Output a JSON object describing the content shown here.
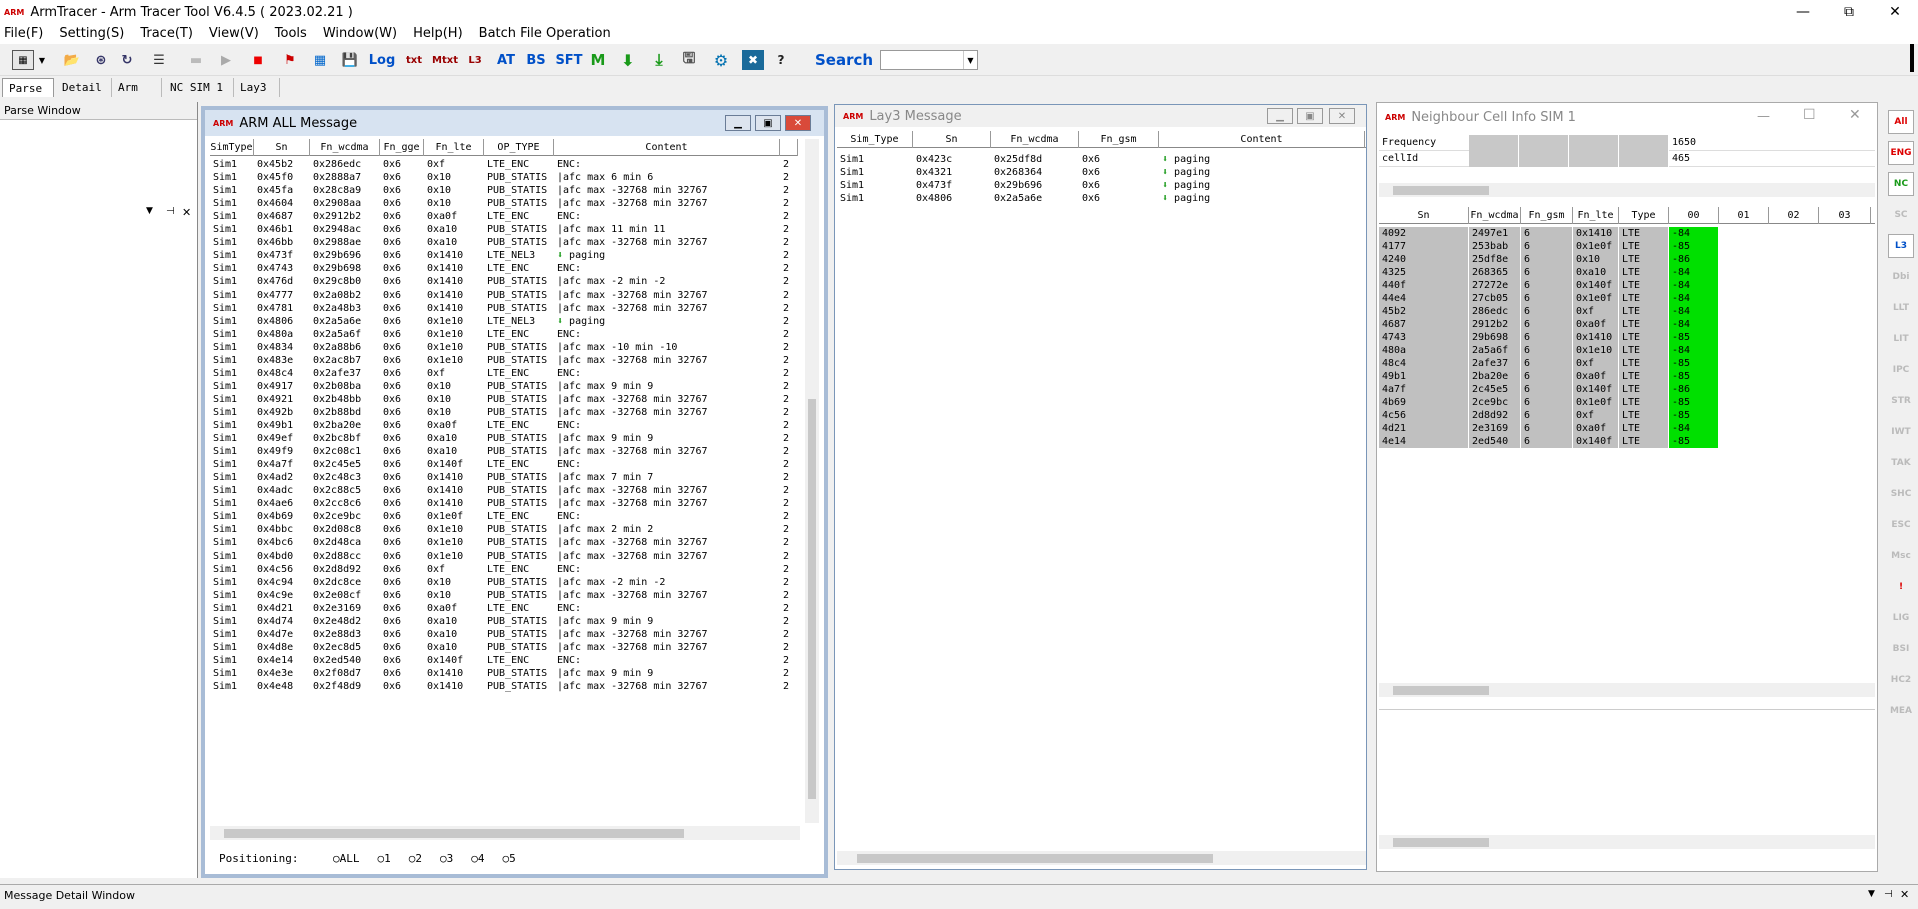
{
  "window": {
    "title": "ArmTracer - Arm Tracer Tool V6.4.5 ( 2023.02.21 )",
    "logo": "ARM",
    "btn_min": "—",
    "btn_max": "⧉",
    "btn_close": "✕"
  },
  "menu": [
    "File(F)",
    "Setting(S)",
    "Trace(T)",
    "View(V)",
    "Tools",
    "Window(W)",
    "Help(H)",
    "Batch File Operation"
  ],
  "toolbar": {
    "log": "Log",
    "txt": "txt",
    "mtxt": "Mtxt",
    "l3": "L3",
    "at": "AT",
    "bs": "BS",
    "sft": "SFT",
    "m": "M",
    "search": "Search"
  },
  "tabs": [
    "Parse",
    "Detail",
    "Arm",
    "NC SIM 1",
    "Lay3"
  ],
  "parse_window": {
    "title": "Parse Window"
  },
  "arm_all": {
    "title": "ARM ALL Message",
    "columns": [
      "SimType",
      "Sn",
      "Fn_wcdma",
      "Fn_gge",
      "Fn_lte",
      "OP_TYPE",
      "Content"
    ],
    "rows": [
      [
        "Sim1",
        "0x45b2",
        "0x286edc",
        "0x6",
        "0xf",
        "LTE_ENC",
        "ENC:"
      ],
      [
        "Sim1",
        "0x45f0",
        "0x2888a7",
        "0x6",
        "0x10",
        "PUB_STATIS",
        "|afc max 6 min 6"
      ],
      [
        "Sim1",
        "0x45fa",
        "0x28c8a9",
        "0x6",
        "0x10",
        "PUB_STATIS",
        "|afc max -32768 min 32767"
      ],
      [
        "Sim1",
        "0x4604",
        "0x2908aa",
        "0x6",
        "0x10",
        "PUB_STATIS",
        "|afc max -32768 min 32767"
      ],
      [
        "Sim1",
        "0x4687",
        "0x2912b2",
        "0x6",
        "0xa0f",
        "LTE_ENC",
        "ENC:"
      ],
      [
        "Sim1",
        "0x46b1",
        "0x2948ac",
        "0x6",
        "0xa10",
        "PUB_STATIS",
        "|afc max 11 min 11"
      ],
      [
        "Sim1",
        "0x46bb",
        "0x2988ae",
        "0x6",
        "0xa10",
        "PUB_STATIS",
        "|afc max -32768 min 32767"
      ],
      [
        "Sim1",
        "0x473f",
        "0x29b696",
        "0x6",
        "0x1410",
        "LTE_NEL3",
        "⬇ paging"
      ],
      [
        "Sim1",
        "0x4743",
        "0x29b698",
        "0x6",
        "0x1410",
        "LTE_ENC",
        "ENC:"
      ],
      [
        "Sim1",
        "0x476d",
        "0x29c8b0",
        "0x6",
        "0x1410",
        "PUB_STATIS",
        "|afc max -2 min -2"
      ],
      [
        "Sim1",
        "0x4777",
        "0x2a08b2",
        "0x6",
        "0x1410",
        "PUB_STATIS",
        "|afc max -32768 min 32767"
      ],
      [
        "Sim1",
        "0x4781",
        "0x2a48b3",
        "0x6",
        "0x1410",
        "PUB_STATIS",
        "|afc max -32768 min 32767"
      ],
      [
        "Sim1",
        "0x4806",
        "0x2a5a6e",
        "0x6",
        "0x1e10",
        "LTE_NEL3",
        "⬇ paging"
      ],
      [
        "Sim1",
        "0x480a",
        "0x2a5a6f",
        "0x6",
        "0x1e10",
        "LTE_ENC",
        "ENC:"
      ],
      [
        "Sim1",
        "0x4834",
        "0x2a88b6",
        "0x6",
        "0x1e10",
        "PUB_STATIS",
        "|afc max -10 min -10"
      ],
      [
        "Sim1",
        "0x483e",
        "0x2ac8b7",
        "0x6",
        "0x1e10",
        "PUB_STATIS",
        "|afc max -32768 min 32767"
      ],
      [
        "Sim1",
        "0x48c4",
        "0x2afe37",
        "0x6",
        "0xf",
        "LTE_ENC",
        "ENC:"
      ],
      [
        "Sim1",
        "0x4917",
        "0x2b08ba",
        "0x6",
        "0x10",
        "PUB_STATIS",
        "|afc max 9 min 9"
      ],
      [
        "Sim1",
        "0x4921",
        "0x2b48bb",
        "0x6",
        "0x10",
        "PUB_STATIS",
        "|afc max -32768 min 32767"
      ],
      [
        "Sim1",
        "0x492b",
        "0x2b88bd",
        "0x6",
        "0x10",
        "PUB_STATIS",
        "|afc max -32768 min 32767"
      ],
      [
        "Sim1",
        "0x49b1",
        "0x2ba20e",
        "0x6",
        "0xa0f",
        "LTE_ENC",
        "ENC:"
      ],
      [
        "Sim1",
        "0x49ef",
        "0x2bc8bf",
        "0x6",
        "0xa10",
        "PUB_STATIS",
        "|afc max 9 min 9"
      ],
      [
        "Sim1",
        "0x49f9",
        "0x2c08c1",
        "0x6",
        "0xa10",
        "PUB_STATIS",
        "|afc max -32768 min 32767"
      ],
      [
        "Sim1",
        "0x4a7f",
        "0x2c45e5",
        "0x6",
        "0x140f",
        "LTE_ENC",
        "ENC:"
      ],
      [
        "Sim1",
        "0x4ad2",
        "0x2c48c3",
        "0x6",
        "0x1410",
        "PUB_STATIS",
        "|afc max 7 min 7"
      ],
      [
        "Sim1",
        "0x4adc",
        "0x2c88c5",
        "0x6",
        "0x1410",
        "PUB_STATIS",
        "|afc max -32768 min 32767"
      ],
      [
        "Sim1",
        "0x4ae6",
        "0x2cc8c6",
        "0x6",
        "0x1410",
        "PUB_STATIS",
        "|afc max -32768 min 32767"
      ],
      [
        "Sim1",
        "0x4b69",
        "0x2ce9bc",
        "0x6",
        "0x1e0f",
        "LTE_ENC",
        "ENC:"
      ],
      [
        "Sim1",
        "0x4bbc",
        "0x2d08c8",
        "0x6",
        "0x1e10",
        "PUB_STATIS",
        "|afc max 2 min 2"
      ],
      [
        "Sim1",
        "0x4bc6",
        "0x2d48ca",
        "0x6",
        "0x1e10",
        "PUB_STATIS",
        "|afc max -32768 min 32767"
      ],
      [
        "Sim1",
        "0x4bd0",
        "0x2d88cc",
        "0x6",
        "0x1e10",
        "PUB_STATIS",
        "|afc max -32768 min 32767"
      ],
      [
        "Sim1",
        "0x4c56",
        "0x2d8d92",
        "0x6",
        "0xf",
        "LTE_ENC",
        "ENC:"
      ],
      [
        "Sim1",
        "0x4c94",
        "0x2dc8ce",
        "0x6",
        "0x10",
        "PUB_STATIS",
        "|afc max -2 min -2"
      ],
      [
        "Sim1",
        "0x4c9e",
        "0x2e08cf",
        "0x6",
        "0x10",
        "PUB_STATIS",
        "|afc max -32768 min 32767"
      ],
      [
        "Sim1",
        "0x4d21",
        "0x2e3169",
        "0x6",
        "0xa0f",
        "LTE_ENC",
        "ENC:"
      ],
      [
        "Sim1",
        "0x4d74",
        "0x2e48d2",
        "0x6",
        "0xa10",
        "PUB_STATIS",
        "|afc max 9 min 9"
      ],
      [
        "Sim1",
        "0x4d7e",
        "0x2e88d3",
        "0x6",
        "0xa10",
        "PUB_STATIS",
        "|afc max -32768 min 32767"
      ],
      [
        "Sim1",
        "0x4d8e",
        "0x2ec8d5",
        "0x6",
        "0xa10",
        "PUB_STATIS",
        "|afc max -32768 min 32767"
      ],
      [
        "Sim1",
        "0x4e14",
        "0x2ed540",
        "0x6",
        "0x140f",
        "LTE_ENC",
        "ENC:"
      ],
      [
        "Sim1",
        "0x4e3e",
        "0x2f08d7",
        "0x6",
        "0x1410",
        "PUB_STATIS",
        "|afc max 9 min 9"
      ],
      [
        "Sim1",
        "0x4e48",
        "0x2f48d9",
        "0x6",
        "0x1410",
        "PUB_STATIS",
        "|afc max -32768 min 32767"
      ]
    ],
    "trail": "2",
    "positioning_label": "Positioning:",
    "radios": [
      "ALL",
      "1",
      "2",
      "3",
      "4",
      "5"
    ]
  },
  "lay3": {
    "title": "Lay3 Message",
    "columns": [
      "Sim_Type",
      "Sn",
      "Fn_wcdma",
      "Fn_gsm",
      "Content"
    ],
    "rows": [
      [
        "Sim1",
        "0x423c",
        "0x25df8d",
        "0x6",
        "⬇ paging"
      ],
      [
        "Sim1",
        "0x4321",
        "0x268364",
        "0x6",
        "⬇ paging"
      ],
      [
        "Sim1",
        "0x473f",
        "0x29b696",
        "0x6",
        "⬇ paging"
      ],
      [
        "Sim1",
        "0x4806",
        "0x2a5a6e",
        "0x6",
        "⬇ paging"
      ]
    ]
  },
  "ncell": {
    "title": "Neighbour Cell Info SIM 1",
    "info": [
      [
        "Frequency",
        "1650"
      ],
      [
        "cellId",
        "465"
      ]
    ],
    "columns": [
      "Sn",
      "Fn_wcdma",
      "Fn_gsm",
      "Fn_lte",
      "Type",
      "00",
      "01",
      "02",
      "03"
    ],
    "rows": [
      [
        "4092",
        "2497e1",
        "6",
        "0x1410",
        "LTE",
        "-84"
      ],
      [
        "4177",
        "253bab",
        "6",
        "0x1e0f",
        "LTE",
        "-85"
      ],
      [
        "4240",
        "25df8e",
        "6",
        "0x10",
        "LTE",
        "-86"
      ],
      [
        "4325",
        "268365",
        "6",
        "0xa10",
        "LTE",
        "-84"
      ],
      [
        "440f",
        "27272e",
        "6",
        "0x140f",
        "LTE",
        "-84"
      ],
      [
        "44e4",
        "27cb05",
        "6",
        "0x1e0f",
        "LTE",
        "-84"
      ],
      [
        "45b2",
        "286edc",
        "6",
        "0xf",
        "LTE",
        "-84"
      ],
      [
        "4687",
        "2912b2",
        "6",
        "0xa0f",
        "LTE",
        "-84"
      ],
      [
        "4743",
        "29b698",
        "6",
        "0x1410",
        "LTE",
        "-85"
      ],
      [
        "480a",
        "2a5a6f",
        "6",
        "0x1e10",
        "LTE",
        "-84"
      ],
      [
        "48c4",
        "2afe37",
        "6",
        "0xf",
        "LTE",
        "-85"
      ],
      [
        "49b1",
        "2ba20e",
        "6",
        "0xa0f",
        "LTE",
        "-85"
      ],
      [
        "4a7f",
        "2c45e5",
        "6",
        "0x140f",
        "LTE",
        "-86"
      ],
      [
        "4b69",
        "2ce9bc",
        "6",
        "0x1e0f",
        "LTE",
        "-85"
      ],
      [
        "4c56",
        "2d8d92",
        "6",
        "0xf",
        "LTE",
        "-85"
      ],
      [
        "4d21",
        "2e3169",
        "6",
        "0xa0f",
        "LTE",
        "-84"
      ],
      [
        "4e14",
        "2ed540",
        "6",
        "0x140f",
        "LTE",
        "-85"
      ]
    ]
  },
  "right_strip": [
    "All",
    "ENG",
    "NC",
    "SC",
    "L3",
    "Dbi",
    "LLT",
    "LIT",
    "IPC",
    "STR",
    "IWT",
    "TAK",
    "SHC",
    "ESC",
    "Msc",
    "!",
    "LIG",
    "BSI",
    "HC2",
    "MEA"
  ],
  "message_detail": {
    "title": "Message Detail Window"
  },
  "colors": {
    "green": "#00e000",
    "gray": "#c0c0c0",
    "mdi_border": "#7a96b8",
    "search_blue": "#0050c8"
  }
}
